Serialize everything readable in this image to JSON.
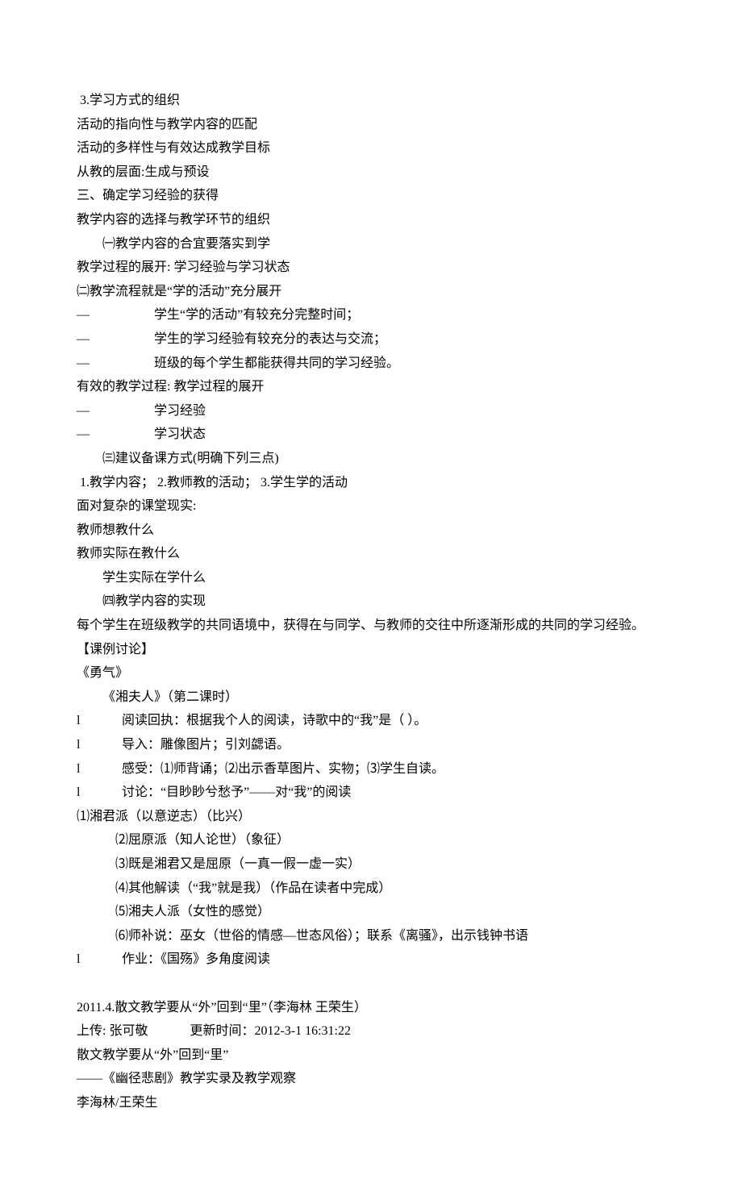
{
  "lines": {
    "p1": " 3.学习方式的组织",
    "p2": "活动的指向性与教学内容的匹配",
    "p3": "活动的多样性与有效达成教学目标",
    "p4": "从教的层面:生成与预设",
    "p5": "三、确定学习经验的获得",
    "p6": "教学内容的选择与教学环节的组织",
    "p7": "㈠教学内容的合宜要落实到学",
    "p8": "教学过程的展开: 学习经验与学习状态",
    "p9": "㈡教学流程就是“学的活动”充分展开",
    "d1": "学生“学的活动”有较充分完整时间；",
    "d2": "学生的学习经验有较充分的表达与交流；",
    "d3": "班级的每个学生都能获得共同的学习经验。",
    "p10": "有效的教学过程: 教学过程的展开",
    "d4": "学习经验",
    "d5": "学习状态",
    "p11": "㈢建议备课方式(明确下列三点)",
    "p12": " 1.教学内容； 2.教师教的活动； 3.学生学的活动",
    "p13": "面对复杂的课堂现实:",
    "p14": "教师想教什么",
    "p15": "教师实际在教什么",
    "p16": "学生实际在学什么",
    "p17": "㈣教学内容的实现",
    "p18": "每个学生在班级教学的共同语境中，获得在与同学、与教师的交往中所逐渐形成的共同的学习经验。",
    "p19": "【课例讨论】",
    "p20": "《勇气》",
    "p21": "《湘夫人》（第二课时）",
    "l1": "阅读回执：根据我个人的阅读，诗歌中的“我”是（     ）。",
    "l2": "导入：雕像图片；引刘勰语。",
    "l3": "感受：⑴师背诵；⑵出示香草图片、实物；⑶学生自读。",
    "l4": "讨论：“目眇眇兮愁予”——对“我”的阅读",
    "p22": "⑴湘君派（以意逆志）（比兴）",
    "p23": "⑵屈原派（知人论世）（象征）",
    "p24": "⑶既是湘君又是屈原（一真一假一虚一实）",
    "p25": "⑷其他解读（“我”就是我）（作品在读者中完成）",
    "p26": "⑸湘夫人派（女性的感觉）",
    "p27": "⑹师补说：巫女（世俗的情感—世态风俗）；联系《离骚》，出示钱钟书语",
    "l5": " 作业：《国殇》多角度阅读",
    "p28": "2011.4.散文教学要从“外”回到“里”（李海林 王荣生）",
    "p29": "上传: 张可敬 　　　更新时间：2012-3-1 16:31:22",
    "p30": "散文教学要从“外”回到“里”",
    "p31": "——《幽径悲剧》教学实录及教学观察",
    "p32": "李海林/王荣生"
  },
  "marks": {
    "dash": "—",
    "l": "l"
  }
}
